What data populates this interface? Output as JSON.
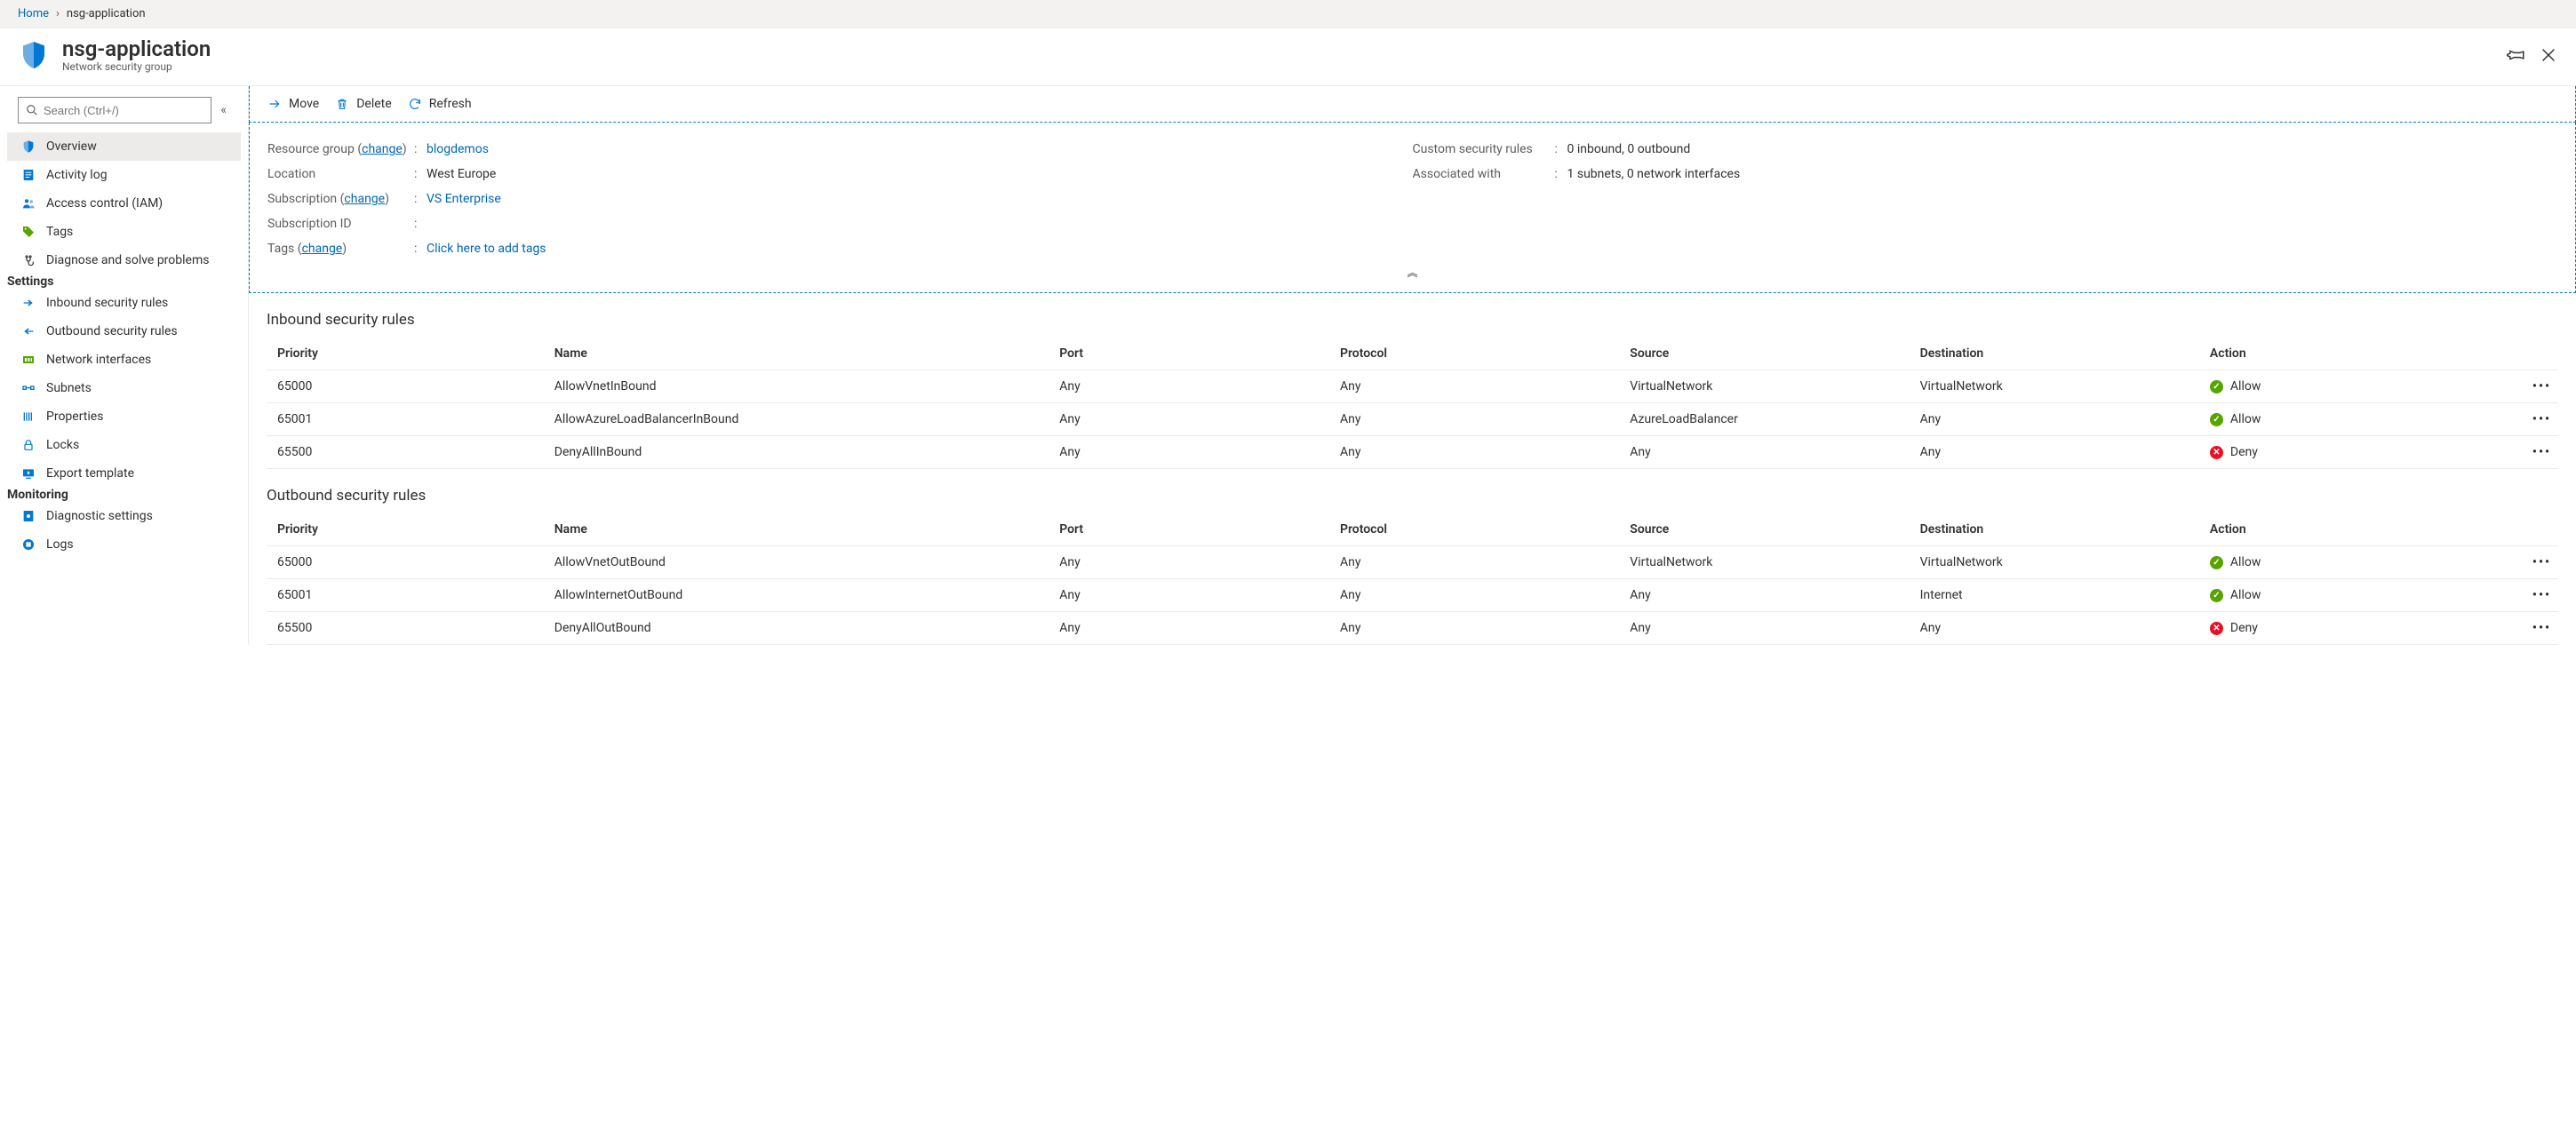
{
  "breadcrumb": {
    "home": "Home",
    "current": "nsg-application"
  },
  "header": {
    "title": "nsg-application",
    "subtitle": "Network security group"
  },
  "search": {
    "placeholder": "Search (Ctrl+/)"
  },
  "sidebar": {
    "items": [
      {
        "label": "Overview"
      },
      {
        "label": "Activity log"
      },
      {
        "label": "Access control (IAM)"
      },
      {
        "label": "Tags"
      },
      {
        "label": "Diagnose and solve problems"
      }
    ],
    "settings_heading": "Settings",
    "settings": [
      {
        "label": "Inbound security rules"
      },
      {
        "label": "Outbound security rules"
      },
      {
        "label": "Network interfaces"
      },
      {
        "label": "Subnets"
      },
      {
        "label": "Properties"
      },
      {
        "label": "Locks"
      },
      {
        "label": "Export template"
      }
    ],
    "monitoring_heading": "Monitoring",
    "monitoring": [
      {
        "label": "Diagnostic settings"
      },
      {
        "label": "Logs"
      }
    ]
  },
  "toolbar": {
    "move": "Move",
    "delete": "Delete",
    "refresh": "Refresh"
  },
  "props": {
    "resource_group_label": "Resource group",
    "change": "change",
    "resource_group_value": "blogdemos",
    "location_label": "Location",
    "location_value": "West Europe",
    "subscription_label": "Subscription",
    "subscription_value": "VS Enterprise",
    "subscription_id_label": "Subscription ID",
    "subscription_id_value": "",
    "tags_label": "Tags",
    "tags_value": "Click here to add tags",
    "custom_rules_label": "Custom security rules",
    "custom_rules_value": "0 inbound, 0 outbound",
    "associated_label": "Associated with",
    "associated_value": "1 subnets, 0 network interfaces"
  },
  "sections": {
    "inbound_title": "Inbound security rules",
    "outbound_title": "Outbound security rules",
    "columns": {
      "priority": "Priority",
      "name": "Name",
      "port": "Port",
      "protocol": "Protocol",
      "source": "Source",
      "destination": "Destination",
      "action": "Action"
    },
    "inbound": [
      {
        "priority": "65000",
        "name": "AllowVnetInBound",
        "port": "Any",
        "protocol": "Any",
        "source": "VirtualNetwork",
        "destination": "VirtualNetwork",
        "action": "Allow"
      },
      {
        "priority": "65001",
        "name": "AllowAzureLoadBalancerInBound",
        "port": "Any",
        "protocol": "Any",
        "source": "AzureLoadBalancer",
        "destination": "Any",
        "action": "Allow"
      },
      {
        "priority": "65500",
        "name": "DenyAllInBound",
        "port": "Any",
        "protocol": "Any",
        "source": "Any",
        "destination": "Any",
        "action": "Deny"
      }
    ],
    "outbound": [
      {
        "priority": "65000",
        "name": "AllowVnetOutBound",
        "port": "Any",
        "protocol": "Any",
        "source": "VirtualNetwork",
        "destination": "VirtualNetwork",
        "action": "Allow"
      },
      {
        "priority": "65001",
        "name": "AllowInternetOutBound",
        "port": "Any",
        "protocol": "Any",
        "source": "Any",
        "destination": "Internet",
        "action": "Allow"
      },
      {
        "priority": "65500",
        "name": "DenyAllOutBound",
        "port": "Any",
        "protocol": "Any",
        "source": "Any",
        "destination": "Any",
        "action": "Deny"
      }
    ]
  }
}
